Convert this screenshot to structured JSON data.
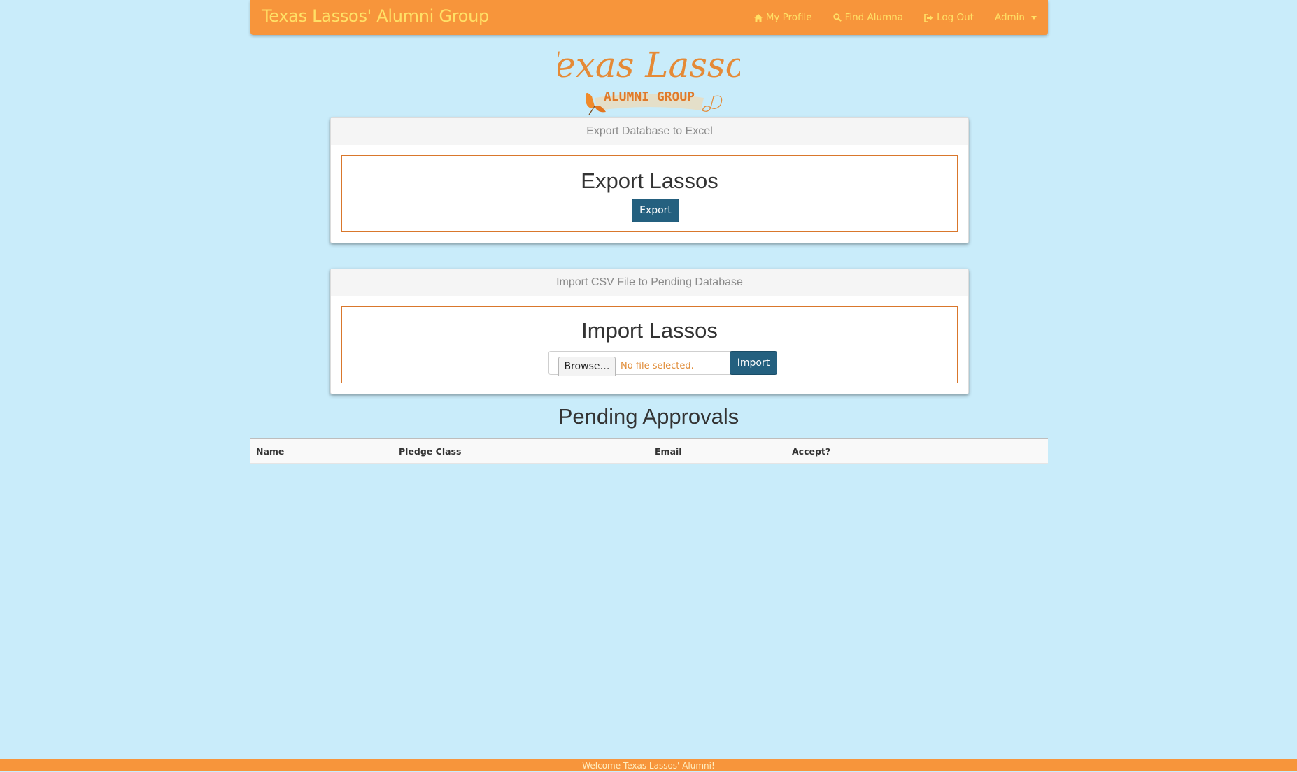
{
  "navbar": {
    "brand": "Texas Lassos' Alumni Group",
    "items": [
      {
        "label": "My Profile",
        "icon": "home-icon"
      },
      {
        "label": "Find Alumna",
        "icon": "search-icon"
      },
      {
        "label": "Log Out",
        "icon": "sign-out-icon"
      },
      {
        "label": "Admin",
        "icon": "caret-down-icon"
      }
    ]
  },
  "logo": {
    "script_text": "Texas Lassos",
    "banner_text": "ALUMNI GROUP"
  },
  "export_panel": {
    "heading": "Export Database to Excel",
    "title": "Export Lassos",
    "button_label": "Export"
  },
  "import_panel": {
    "heading": "Import CSV File to Pending Database",
    "title": "Import Lassos",
    "browse_label": "Browse…",
    "file_status": "No file selected.",
    "button_label": "Import"
  },
  "pending": {
    "title": "Pending Approvals",
    "columns": [
      "Name",
      "Pledge Class",
      "Email",
      "Accept?"
    ],
    "rows": []
  },
  "footer": {
    "text": "Welcome Texas Lassos' Alumni!"
  },
  "colors": {
    "navbar": "#f7953b",
    "nav_text": "#ffe066",
    "background": "#c9ecfa",
    "primary_button": "#24607f",
    "box_border": "#d9772c"
  }
}
